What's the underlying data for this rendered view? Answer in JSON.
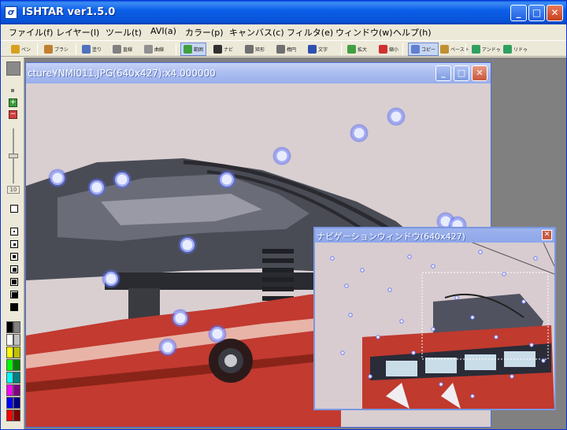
{
  "app": {
    "title": "ISHTAR ver1.5.0",
    "icon_glyph": "σ",
    "minimize": "_",
    "maximize": "□",
    "close": "✕"
  },
  "menu": [
    "ファイル(f)",
    "レイヤー(l)",
    "ツール(t)",
    "AVI(a)",
    "カラー(p)",
    "キャンバス(c)",
    "フィルタ(e)",
    "ウィンドウ(w)",
    "ヘルプ(h)"
  ],
  "toolbar": [
    {
      "label": "ペン",
      "color": "#d9a020"
    },
    {
      "label": "ブラシ",
      "color": "#c08030"
    },
    {
      "label": "塗り",
      "color": "#5070c0"
    },
    {
      "label": "直線",
      "color": "#808080"
    },
    {
      "label": "曲線",
      "color": "#909090"
    },
    {
      "label": "範囲",
      "color": "#40a040"
    },
    {
      "label": "ナビ",
      "color": "#303030"
    },
    {
      "label": "矩形",
      "color": "#707070"
    },
    {
      "label": "楕円",
      "color": "#707070"
    },
    {
      "label": "文字",
      "color": "#3050b0"
    },
    {
      "label": "拡大",
      "color": "#40a040"
    },
    {
      "label": "縮小",
      "color": "#d03030"
    },
    {
      "label": "コピー",
      "color": "#6080d0"
    },
    {
      "label": "ペースト",
      "color": "#c09030"
    },
    {
      "label": "アンドゥ",
      "color": "#30a060"
    },
    {
      "label": "リドゥ",
      "color": "#30a060"
    }
  ],
  "image_window": {
    "title": "cture¥NMI011.JPG(640x427):x4.000000",
    "minimize": "_",
    "maximize": "□",
    "close": "✕"
  },
  "nav_window": {
    "title": "ナビゲーションウィンドウ(640x427)",
    "close": "✕"
  },
  "palette_colors": [
    "#000000",
    "#808080",
    "#ffffff",
    "#c0c0c0",
    "#ffff00",
    "#c0c000",
    "#00ff00",
    "#008000",
    "#00ffff",
    "#008080",
    "#ff00ff",
    "#800080",
    "#0000ff",
    "#000080",
    "#ff0000",
    "#800000"
  ],
  "left_tool_values": {
    "zoom_box_label": "10"
  }
}
